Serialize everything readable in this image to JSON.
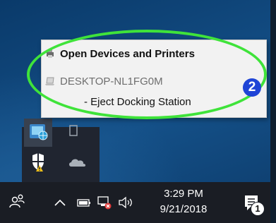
{
  "context_menu": {
    "items": [
      {
        "label": "Open Devices and Printers",
        "icon": "devices-printers-icon"
      },
      {
        "label": "DESKTOP-NL1FG0M",
        "icon": "laptop-icon"
      },
      {
        "label": "- Eject Docking Station"
      }
    ]
  },
  "annotation": {
    "callout_number": "2",
    "highlight_color": "#3fe33a",
    "badge_color": "#1f44d6"
  },
  "tray_flyout": {
    "icons": [
      "network-globe-icon",
      "blank-window-icon",
      "windows-defender-icon",
      "onedrive-cloud-icon"
    ]
  },
  "taskbar": {
    "icons": [
      "people-icon",
      "chevron-up-icon",
      "battery-icon",
      "network-icon",
      "volume-icon"
    ],
    "clock": {
      "time": "3:29 PM",
      "date": "9/21/2018"
    },
    "notifications": {
      "icon": "action-center-icon",
      "count": "1"
    }
  }
}
